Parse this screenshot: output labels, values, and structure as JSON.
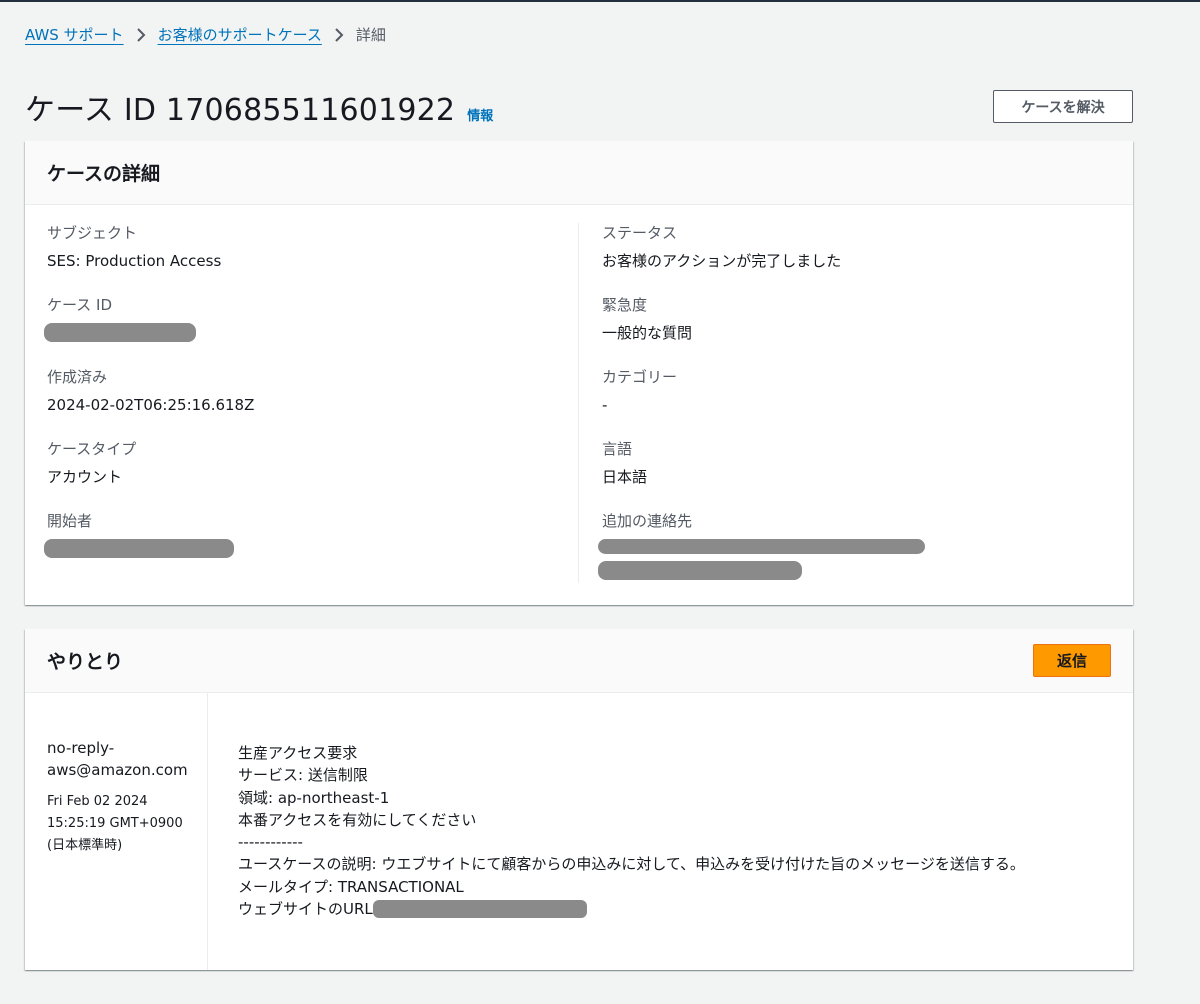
{
  "breadcrumb": {
    "items": [
      "AWS サポート",
      "お客様のサポートケース"
    ],
    "current": "詳細"
  },
  "header": {
    "title": "ケース ID 170685511601922",
    "info": "情報",
    "resolve_button": "ケースを解決"
  },
  "details": {
    "title": "ケースの詳細",
    "left": [
      {
        "label": "サブジェクト",
        "value": "SES: Production Access"
      },
      {
        "label": "ケース ID",
        "value": ""
      },
      {
        "label": "作成済み",
        "value": "2024-02-02T06:25:16.618Z"
      },
      {
        "label": "ケースタイプ",
        "value": "アカウント"
      },
      {
        "label": "開始者",
        "value": ""
      }
    ],
    "right": [
      {
        "label": "ステータス",
        "value": "お客様のアクションが完了しました"
      },
      {
        "label": "緊急度",
        "value": "一般的な質問"
      },
      {
        "label": "カテゴリー",
        "value": "-"
      },
      {
        "label": "言語",
        "value": "日本語"
      },
      {
        "label": "追加の連絡先",
        "value": ""
      }
    ]
  },
  "correspondence": {
    "title": "やりとり",
    "reply_button": "返信",
    "messages": [
      {
        "sender": "no-reply-aws@amazon.com",
        "date": "Fri Feb 02 2024 15:25:19 GMT+0900 (日本標準時)",
        "lines": [
          "生産アクセス要求",
          "サービス: 送信制限",
          "領域: ap-northeast-1",
          "本番アクセスを有効にしてください",
          "------------",
          "ユースケースの説明: ウエブサイトにて顧客からの申込みに対して、申込みを受け付けた旨のメッセージを送信する。",
          "メールタイプ: TRANSACTIONAL",
          "ウェブサイトのURL"
        ]
      }
    ]
  }
}
